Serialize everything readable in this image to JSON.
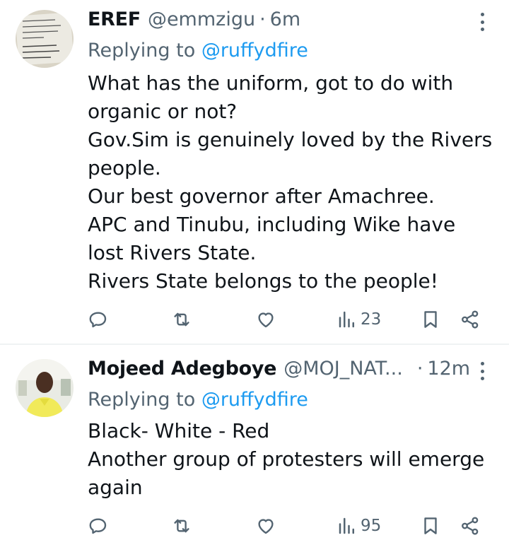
{
  "tweets": [
    {
      "name": "EREF",
      "handle": "@emmzigu",
      "sep": "·",
      "time": "6m",
      "replying_prefix": "Replying to ",
      "replying_to": "@ruffydfire",
      "lines": [
        "What has the uniform, got to do with",
        "organic or not?",
        "Gov.Sim is genuinely loved by the Rivers",
        "people.",
        "Our best governor after Amachree.",
        "APC and Tinubu, including Wike have",
        "lost Rivers State.",
        "Rivers State belongs to the people!"
      ],
      "views": "23"
    },
    {
      "name": "Mojeed Adegboye",
      "handle": "@MOJ_NAT...",
      "sep": "·",
      "time": "12m",
      "replying_prefix": "Replying to ",
      "replying_to": "@ruffydfire",
      "lines": [
        "Black- White - Red",
        "Another group of protesters will emerge",
        "again"
      ],
      "views": "95"
    }
  ],
  "colors": {
    "accent": "#1d9bf0",
    "secondary": "#536471",
    "text": "#0f1419",
    "divider": "#eff3f4"
  },
  "icons": [
    "reply-icon",
    "retweet-icon",
    "like-icon",
    "views-icon",
    "bookmark-icon",
    "share-icon",
    "more-icon"
  ]
}
